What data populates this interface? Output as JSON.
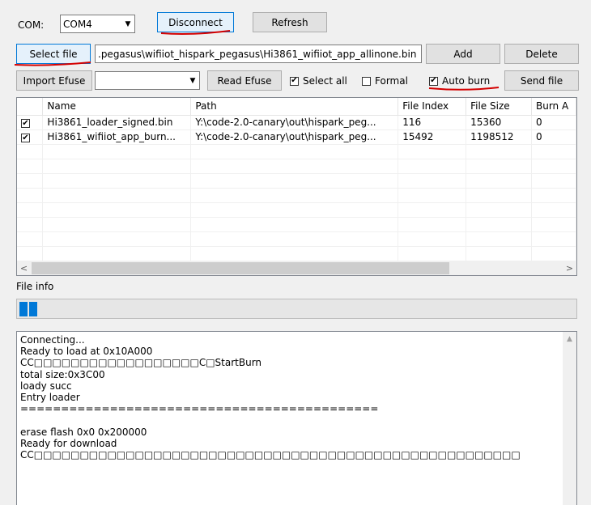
{
  "toolbar": {
    "com_label": "COM:",
    "com_value": "COM4",
    "disconnect": "Disconnect",
    "refresh": "Refresh",
    "select_file": "Select file",
    "file_path": ".pegasus\\wifiiot_hispark_pegasus\\Hi3861_wifiiot_app_allinone.bin",
    "add": "Add",
    "delete": "Delete",
    "import_efuse": "Import Efuse",
    "efuse_value": "",
    "read_efuse": "Read Efuse",
    "select_all": "Select all",
    "formal": "Formal",
    "auto_burn": "Auto burn",
    "send_file": "Send file"
  },
  "table": {
    "columns": [
      "Name",
      "Path",
      "File Index",
      "File Size",
      "Burn A"
    ],
    "rows": [
      {
        "checked": true,
        "name": "Hi3861_loader_signed.bin",
        "path": "Y:\\code-2.0-canary\\out\\hispark_peg...",
        "index": "116",
        "size": "15360",
        "burn": "0"
      },
      {
        "checked": true,
        "name": "Hi3861_wifiiot_app_burn...",
        "path": "Y:\\code-2.0-canary\\out\\hispark_peg...",
        "index": "15492",
        "size": "1198512",
        "burn": "0"
      }
    ]
  },
  "file_info_label": "File info",
  "progress": {
    "filled_blocks": 2
  },
  "log": {
    "lines": [
      "Connecting...",
      "Ready to load at 0x10A000",
      "CC□□□□□□□□□□□□□□□□□□C□StartBurn",
      "total size:0x3C00",
      "loady succ",
      "Entry loader",
      "============================================",
      "",
      "erase flash 0x0 0x200000",
      "Ready for download",
      "CC□□□□□□□□□□□□□□□□□□□□□□□□□□□□□□□□□□□□□□□□□□□□□□□□□□□□□"
    ]
  },
  "colors": {
    "accent": "#0078d7",
    "annotation": "#d40000"
  }
}
